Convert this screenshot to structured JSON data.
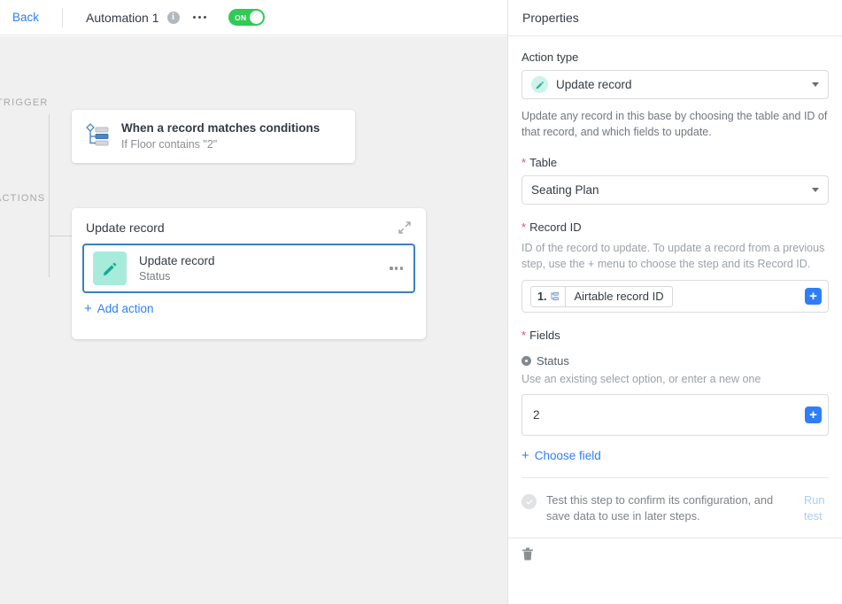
{
  "topbar": {
    "back_label": "Back",
    "automation_title": "Automation 1",
    "info_icon": "info-icon",
    "overflow_icon": "ellipsis-icon",
    "toggle_label": "ON",
    "toggle_on": true,
    "toggle_color": "#2ecc54"
  },
  "canvas": {
    "trigger_section_label": "TRIGGER",
    "actions_section_label": "ACTIONS",
    "trigger": {
      "icon": "record-matches-conditions-icon",
      "title": "When a record matches conditions",
      "subtitle": "If Floor contains \"2\""
    },
    "actions_panel": {
      "header": "Update record",
      "expand_icon": "collapse-diagonal-icon",
      "row": {
        "icon": "pencil-icon",
        "icon_bg": "#a7ebdb",
        "icon_color": "#17a894",
        "title": "Update record",
        "subtitle": "Status",
        "overflow_icon": "ellipsis-icon",
        "selected": true,
        "selected_border": "#3a7fc4"
      },
      "add_action_label": "Add action",
      "add_action_icon": "plus-icon"
    }
  },
  "properties": {
    "header": "Properties",
    "action_type": {
      "label": "Action type",
      "icon": "pencil-circle-icon",
      "value": "Update record",
      "caret_icon": "chevron-down-icon",
      "description": "Update any record in this base by choosing the table and ID of that record, and which fields to update."
    },
    "table": {
      "label": "Table",
      "required": true,
      "value": "Seating Plan",
      "caret_icon": "chevron-down-icon"
    },
    "record_id": {
      "label": "Record ID",
      "required": true,
      "helper": "ID of the record to update. To update a record from a previous step, use the + menu to choose the step and its Record ID.",
      "token_number": "1.",
      "token_icon": "step-reference-icon",
      "token_label": "Airtable record ID",
      "insert_icon": "plus-icon",
      "insert_color": "#2d7ff9"
    },
    "fields": {
      "label": "Fields",
      "required": true,
      "entries": [
        {
          "icon": "single-select-icon",
          "name": "Status",
          "helper": "Use an existing select option, or enter a new one",
          "value": "2",
          "insert_icon": "plus-icon"
        }
      ],
      "choose_field_label": "Choose field",
      "choose_field_icon": "plus-icon"
    },
    "test": {
      "status_icon": "check-circle-icon",
      "text": "Test this step to confirm its configuration, and save data to use in later steps.",
      "run_test_label": "Run test",
      "run_test_color": "#aaccf5"
    },
    "footer": {
      "delete_icon": "trash-icon"
    }
  }
}
